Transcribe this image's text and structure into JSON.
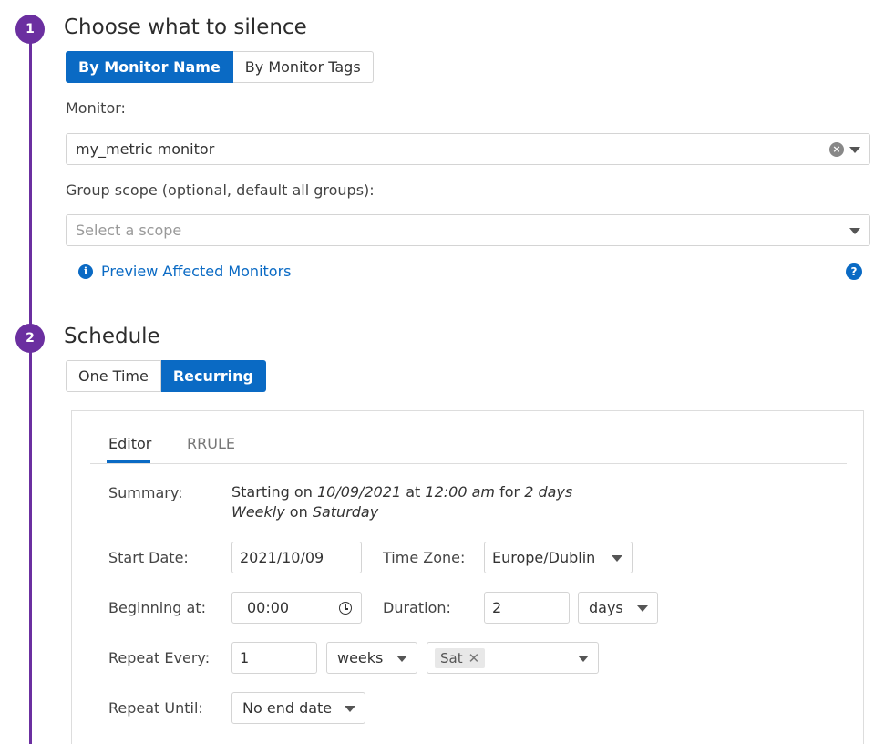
{
  "steps": [
    {
      "number": "1",
      "title": "Choose what to silence"
    },
    {
      "number": "2",
      "title": "Schedule"
    }
  ],
  "silence": {
    "tabs": [
      "By Monitor Name",
      "By Monitor Tags"
    ],
    "active_tab": "By Monitor Name",
    "monitor_label": "Monitor:",
    "monitor_value": "my_metric monitor",
    "scope_label": "Group scope (optional, default all groups):",
    "scope_placeholder": "Select a scope",
    "preview_link": "Preview Affected Monitors"
  },
  "schedule": {
    "tabs": [
      "One Time",
      "Recurring"
    ],
    "active_tab": "Recurring",
    "editor_tabs": [
      "Editor",
      "RRULE"
    ],
    "active_editor_tab": "Editor",
    "summary_label": "Summary:",
    "summary": {
      "starting_on": "Starting on",
      "date": "10/09/2021",
      "at": "at",
      "time": "12:00 am",
      "for": "for",
      "duration": "2 days",
      "frequency": "Weekly",
      "on": "on",
      "day": "Saturday"
    },
    "start_date_label": "Start Date:",
    "start_date": "2021/10/09",
    "time_zone_label": "Time Zone:",
    "time_zone": "Europe/Dublin",
    "beginning_at_label": "Beginning at:",
    "beginning_at": "00:00",
    "duration_label": "Duration:",
    "duration_value": "2",
    "duration_unit": "days",
    "repeat_every_label": "Repeat Every:",
    "repeat_every_value": "1",
    "repeat_every_unit": "weeks",
    "repeat_days": [
      "Sat"
    ],
    "repeat_until_label": "Repeat Until:",
    "repeat_until": "No end date"
  },
  "colors": {
    "accent": "#0a6ac4",
    "timeline": "#6b2fa0"
  }
}
